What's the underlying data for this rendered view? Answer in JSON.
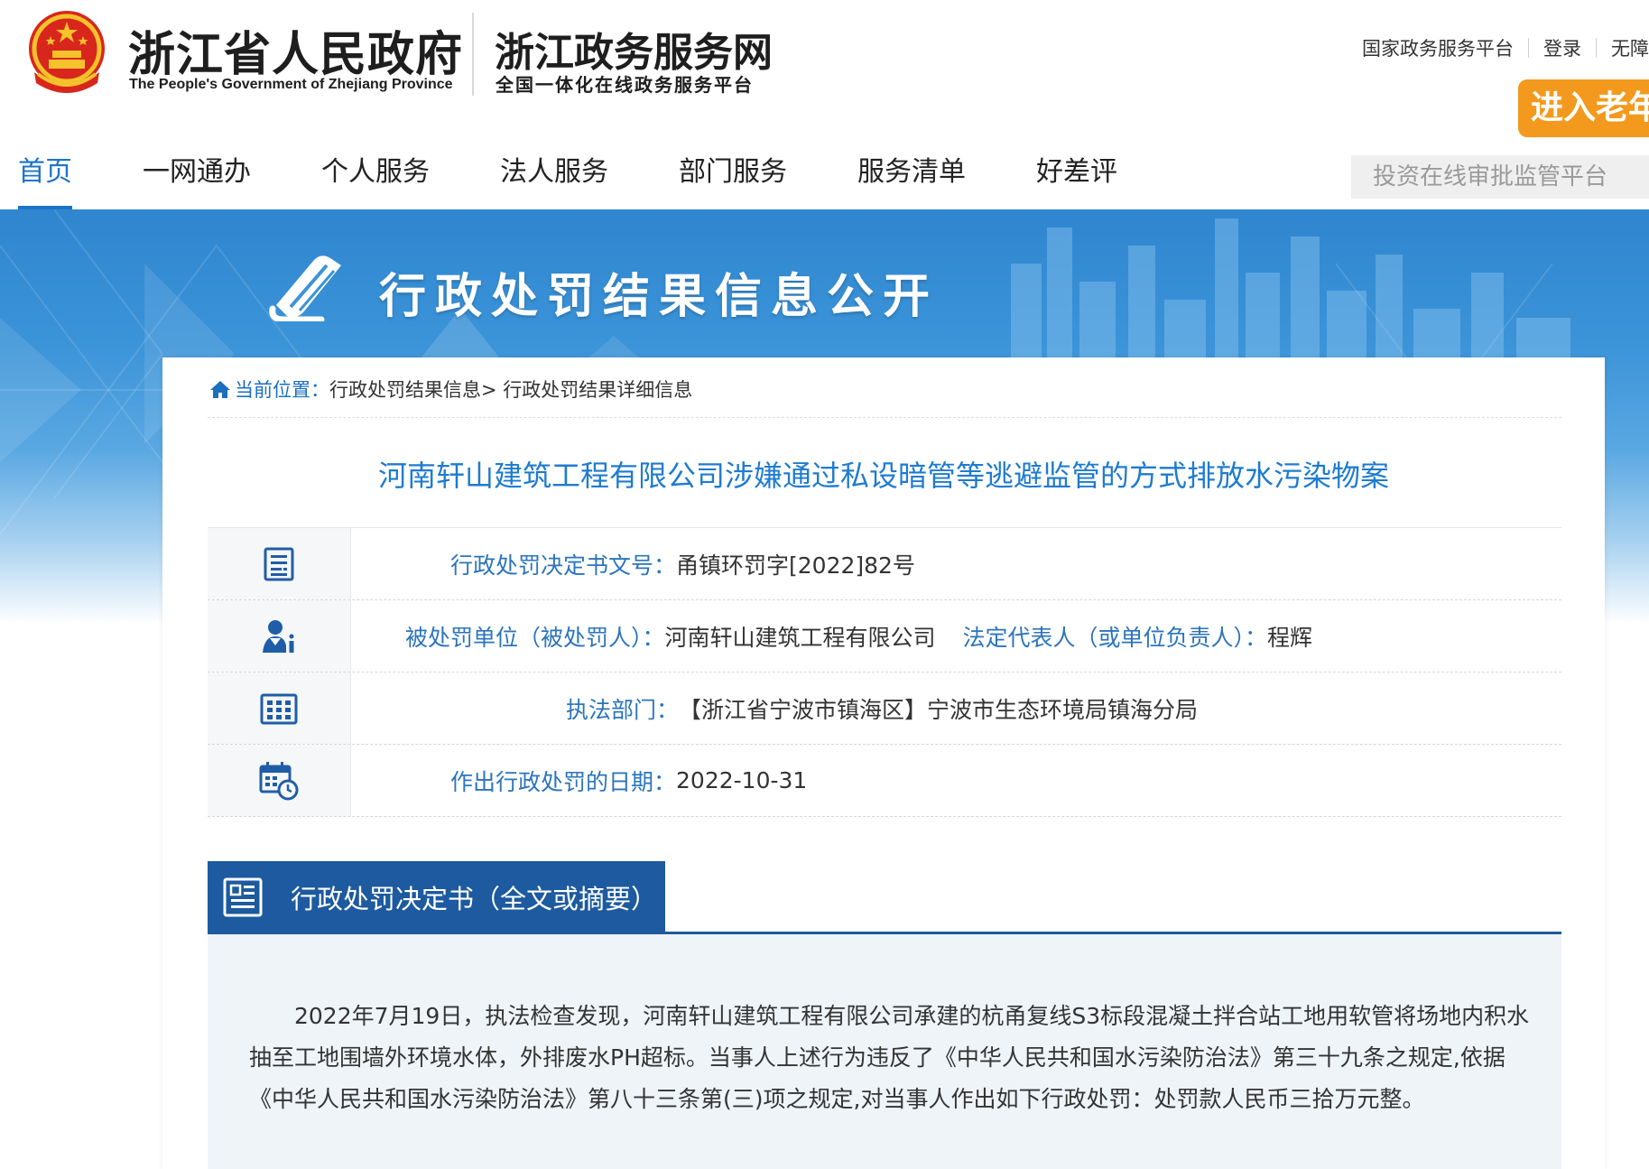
{
  "header": {
    "gov_name_cn": "浙江省人民政府",
    "gov_name_en": "The People's Government of Zhejiang Province",
    "site_name": "浙江政务服务网",
    "site_subtitle": "全国一体化在线政务服务平台",
    "top_links": [
      "国家政务服务平台",
      "登录",
      "无障"
    ],
    "elder_button": "进入老年"
  },
  "nav": {
    "items": [
      "首页",
      "一网通办",
      "个人服务",
      "法人服务",
      "部门服务",
      "服务清单",
      "好差评"
    ],
    "active_index": 0,
    "search_placeholder": "投资在线审批监管平台"
  },
  "banner": {
    "title": "行政处罚结果信息公开"
  },
  "breadcrumb": {
    "current_label": "当前位置：",
    "path": "行政处罚结果信息> 行政处罚结果详细信息"
  },
  "case": {
    "title": "河南轩山建筑工程有限公司涉嫌通过私设暗管等逃避监管的方式排放水污染物案",
    "rows": [
      {
        "icon": "document-list-icon",
        "label": "行政处罚决定书文号：",
        "value": "甬镇环罚字[2022]82号"
      },
      {
        "icon": "person-info-icon",
        "label": "被处罚单位（被处罚人）：",
        "value": "河南轩山建筑工程有限公司",
        "label2": "法定代表人（或单位负责人）：",
        "value2": "程辉"
      },
      {
        "icon": "building-icon",
        "label": "执法部门：",
        "value": "【浙江省宁波市镇海区】宁波市生态环境局镇海分局"
      },
      {
        "icon": "calendar-clock-icon",
        "label": "作出行政处罚的日期：",
        "value": "2022-10-31"
      }
    ]
  },
  "decision": {
    "tab_label": "行政处罚决定书（全文或摘要）",
    "body": "2022年7月19日，执法检查发现，河南轩山建筑工程有限公司承建的杭甬复线S3标段混凝土拌合站工地用软管将场地内积水抽至工地围墙外环境水体，外排废水PH超标。当事人上述行为违反了《中华人民共和国水污染防治法》第三十九条之规定,依据《中华人民共和国水污染防治法》第八十三条第(三)项之规定,对当事人作出如下行政处罚：处罚款人民币三拾万元整。"
  },
  "colors": {
    "primary_blue": "#1b74c9",
    "label_blue": "#2b74bd",
    "dark_blue": "#1d5a9f",
    "orange": "#f39a1e"
  }
}
